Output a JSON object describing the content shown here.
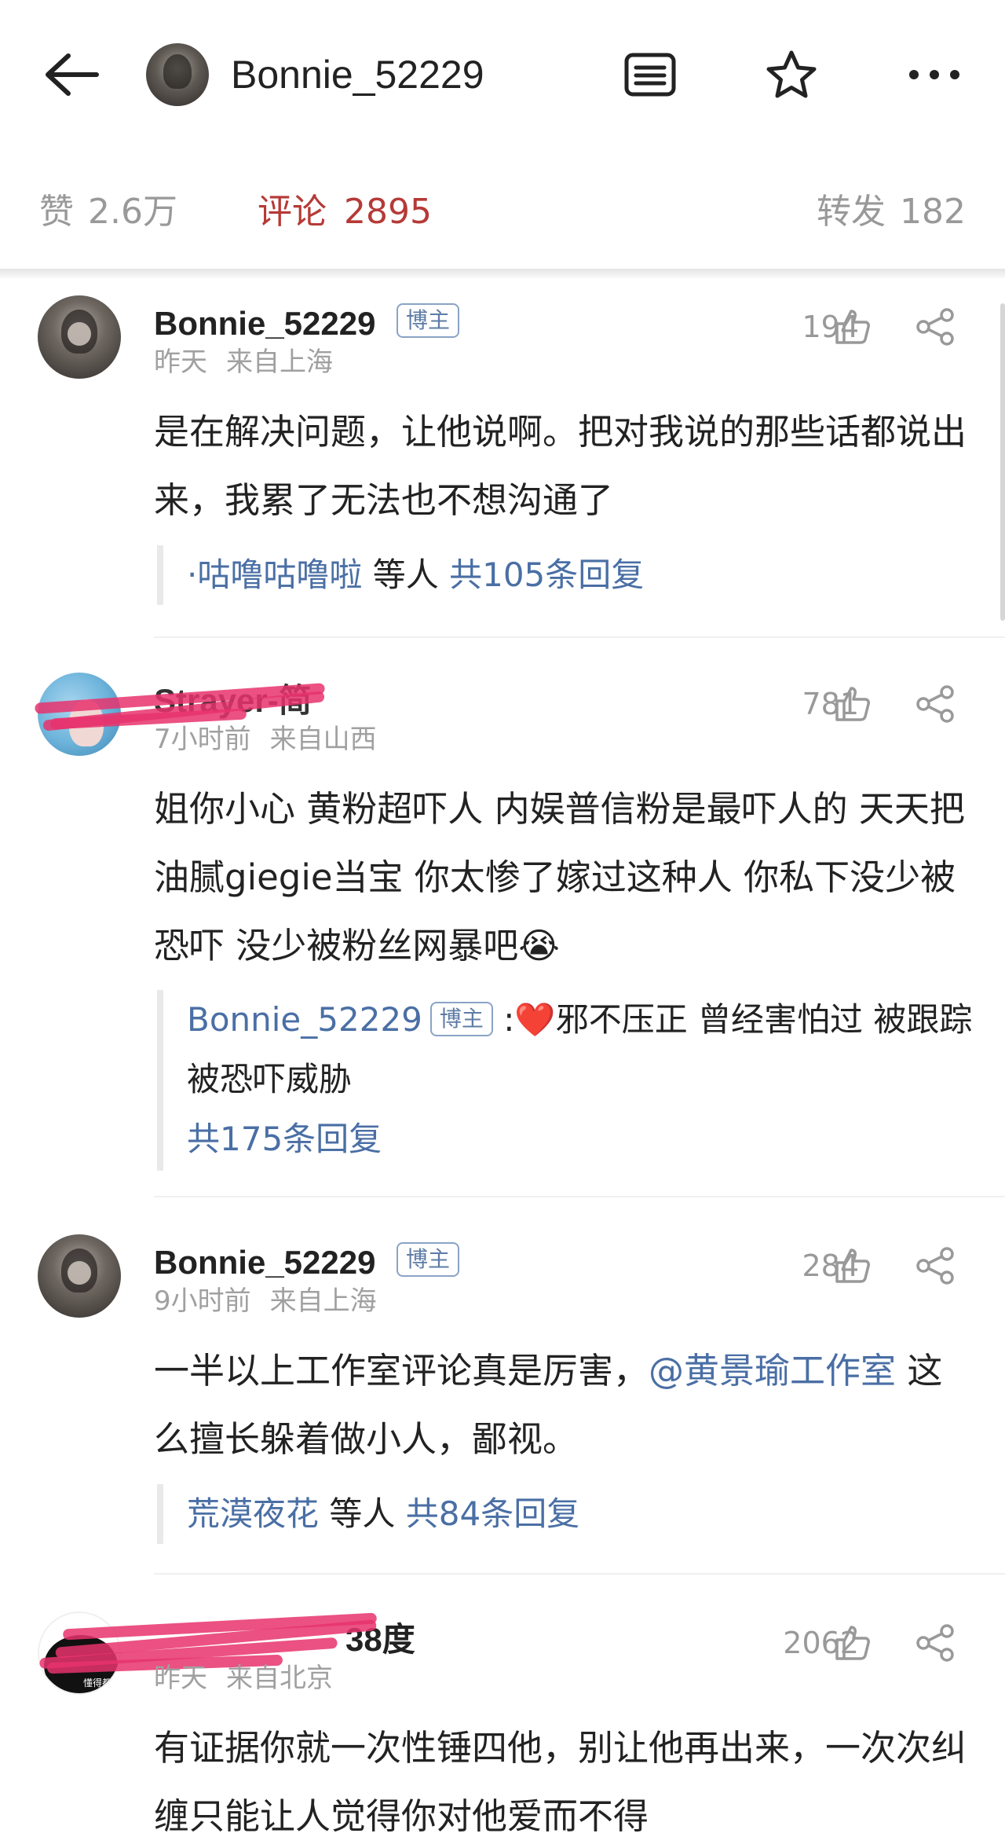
{
  "header": {
    "back_icon": "back-arrow-icon",
    "author_name": "Bonnie_52229",
    "icons": [
      "article-icon",
      "star-icon",
      "more-icon"
    ]
  },
  "stats": {
    "likes_label": "赞",
    "likes_value": "2.6万",
    "comments_label": "评论",
    "comments_value": "2895",
    "reposts_label": "转发",
    "reposts_value": "182"
  },
  "colors": {
    "accent_red": "#b53a37",
    "link_blue": "#4a6fa5",
    "muted_gray": "#999999",
    "redaction_pink": "#e8336d"
  },
  "comments": [
    {
      "name": "Bonnie_52229",
      "badge": "博主",
      "time": "昨天",
      "location": "来自上海",
      "likes": "194",
      "text": "是在解决问题，让他说啊。把对我说的那些话都说出来，我累了无法也不想沟通了",
      "replies": {
        "users": "·咕噜咕噜啦",
        "suffix": "等人",
        "count": "共105条回复"
      }
    },
    {
      "name": "Strayer-简",
      "time": "7小时前",
      "location": "来自山西",
      "likes": "781",
      "text": "姐你小心 黄粉超吓人 内娱普信粉是最吓人的 天天把油腻giegie当宝 你太惨了嫁过这种人 你私下没少被恐吓 没少被粉丝网暴吧😭",
      "replies": {
        "reply_user": "Bonnie_52229",
        "reply_badge": "博主",
        "reply_text": ":❤️邪不压正 曾经害怕过 被跟踪被恐吓威胁",
        "count": "共175条回复"
      }
    },
    {
      "name": "Bonnie_52229",
      "badge": "博主",
      "time": "9小时前",
      "location": "来自上海",
      "likes": "284",
      "text_before": "一半以上工作室评论真是厉害，",
      "mention": "@黄景瑜工作室",
      "text_after": " 这么擅长躲着做小人，鄙视。",
      "replies": {
        "users": "荒漠夜花",
        "suffix": "等人",
        "count": "共84条回复"
      }
    },
    {
      "name": "38度",
      "time": "昨天",
      "location": "来自北京",
      "likes": "2062",
      "avatar_caption": "懂得都",
      "text": "有证据你就一次性锤四他，别让他再出来，一次次纠缠只能让人觉得你对他爱而不得"
    }
  ]
}
